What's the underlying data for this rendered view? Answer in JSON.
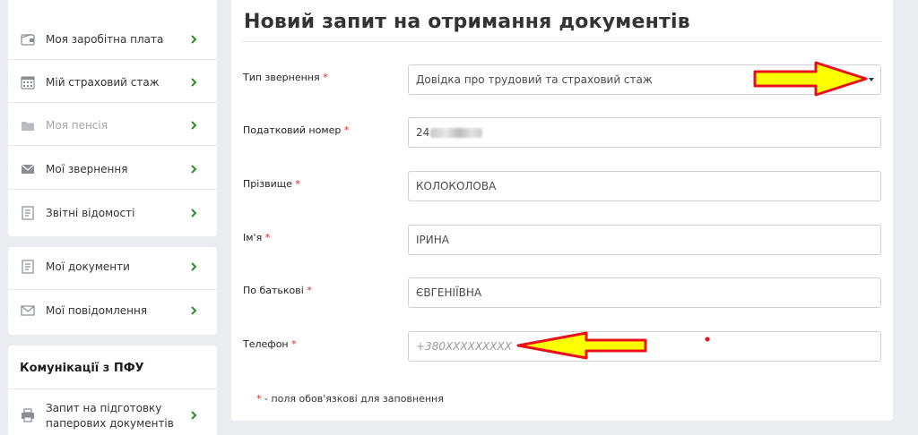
{
  "sidebar": {
    "items": [
      {
        "label": "Моя заробітна плата",
        "icon": "wallet-icon"
      },
      {
        "label": "Мій страховий стаж",
        "icon": "calendar-icon"
      },
      {
        "label": "Моя пенсія",
        "icon": "folder-icon"
      },
      {
        "label": "Мої звернення",
        "icon": "envelope-icon"
      },
      {
        "label": "Звітні відомості",
        "icon": "report-icon"
      }
    ],
    "items2": [
      {
        "label": "Мої документи",
        "icon": "document-icon"
      },
      {
        "label": "Мої повідомлення",
        "icon": "message-icon"
      }
    ],
    "section_title": "Комунікації з ПФУ",
    "items3": [
      {
        "label_line1": "Запит на підготовку",
        "label_line2": "паперових документів",
        "icon": "printer-icon"
      }
    ]
  },
  "form": {
    "title": "Новий запит на отримання документів",
    "required_mark": "*",
    "fields": {
      "request_type": {
        "label": "Тип звернення",
        "value": "Довідка про трудовий та страховий стаж"
      },
      "tax_number": {
        "label": "Податковий номер",
        "value": "24"
      },
      "surname": {
        "label": "Прізвище",
        "value": "КОЛОКОЛОВА"
      },
      "first_name": {
        "label": "Ім'я",
        "value": "ІРИНА"
      },
      "patronymic": {
        "label": "По батькові",
        "value": "ЄВГЕНІЇВНА"
      },
      "phone": {
        "label": "Телефон",
        "value": "",
        "placeholder": "+380XXXXXXXXX"
      }
    },
    "note": "- поля обов'язкові для заповнення"
  },
  "colors": {
    "accent_green": "#2e8b2e",
    "required_red": "#d9271f",
    "arrow_fill": "#ffff00",
    "arrow_stroke": "#e8101a"
  }
}
